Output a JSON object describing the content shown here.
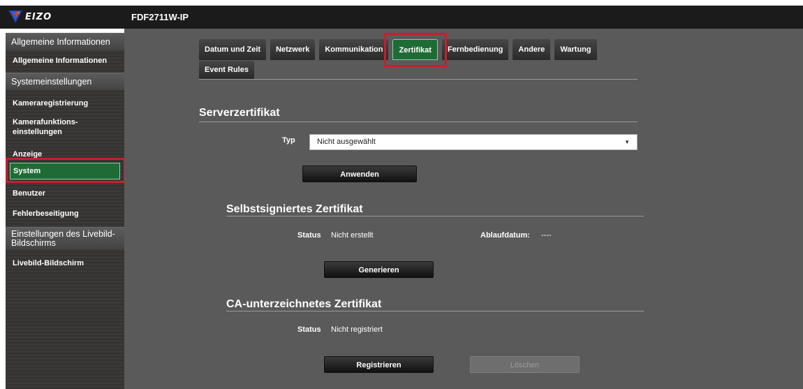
{
  "header": {
    "logo_text": "EIZO",
    "product": "FDF2711W-IP"
  },
  "sidebar": {
    "sections": [
      {
        "title": "Allgemeine Informationen",
        "items": [
          "Allgemeine Informationen"
        ]
      },
      {
        "title": "Systemeinstellungen",
        "items": [
          "Kameraregistrierung",
          "Kamerafunktions-",
          "einstellungen",
          "Anzeige",
          "System",
          "Benutzer",
          "Fehlerbeseitigung"
        ]
      },
      {
        "title_line1": "Einstellungen des Livebild-",
        "title_line2": "Bildschirms",
        "items": [
          "Livebild-Bildschirm"
        ]
      }
    ],
    "selected": "System"
  },
  "tabs": [
    "Datum und Zeit",
    "Netzwerk",
    "Kommunikation",
    "Zertifikat",
    "Fernbedienung",
    "Andere",
    "Wartung",
    "Event Rules"
  ],
  "active_tab": "Zertifikat",
  "server_cert": {
    "title": "Serverzertifikat",
    "type_label": "Typ",
    "type_value": "Nicht ausgewählt",
    "apply_button": "Anwenden"
  },
  "self_signed": {
    "title": "Selbstsigniertes Zertifikat",
    "status_label": "Status",
    "status_value": "Nicht erstellt",
    "expiry_label": "Ablaufdatum:",
    "expiry_value": "----",
    "generate_button": "Generieren"
  },
  "ca_signed": {
    "title": "CA-unterzeichnetes Zertifikat",
    "status_label": "Status",
    "status_value": "Nicht registriert",
    "register_button": "Registrieren",
    "delete_button": "Löschen"
  },
  "colors": {
    "accent_green": "#1f6b35",
    "highlight_red": "#c71f2d",
    "background": "#5a5a5a",
    "topbar": "#1b1b1b"
  }
}
